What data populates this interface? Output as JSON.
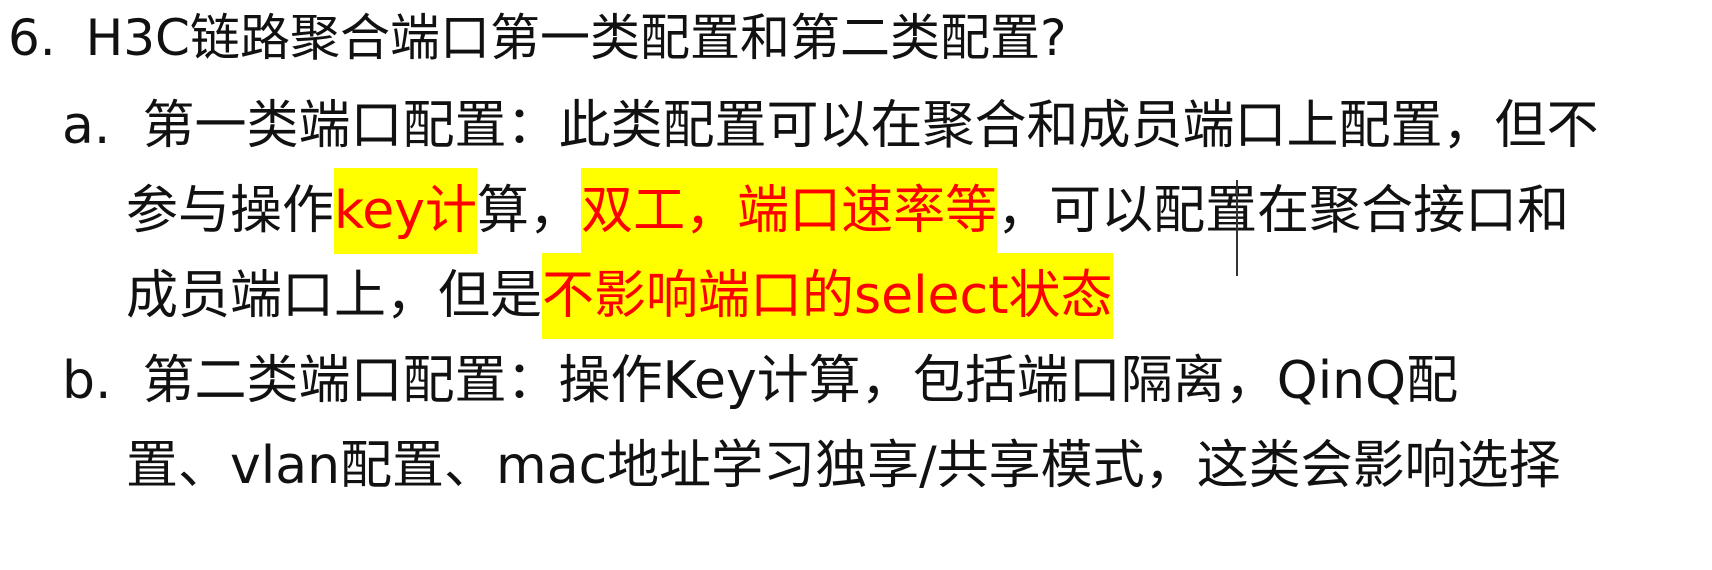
{
  "question": {
    "number": "6.",
    "title": "H3C链路聚合端口第一类配置和第二类配置?"
  },
  "item_a": {
    "marker": "a.",
    "line1": "第一类端口配置：此类配置可以在聚合和成员端口上配置，但不",
    "line2_part1": "参与操作",
    "line2_hl1": "key计",
    "line2_part2": "算，",
    "line2_hl2": "双工，端口速率等",
    "line2_part3": "，可以配置在聚合接口和",
    "line3_part1": "成员端口上，但是",
    "line3_hl": "不影响端口的select状态"
  },
  "item_b": {
    "marker": "b.",
    "line1": "第二类端口配置：操作Key计算，包括端口隔离，QinQ配",
    "line2": "置、vlan配置、mac地址学习独享/共享模式，这类会影响选择"
  },
  "colors": {
    "highlight_bg": "#ffff00",
    "highlight_text": "#ff0000",
    "text": "#111111"
  }
}
